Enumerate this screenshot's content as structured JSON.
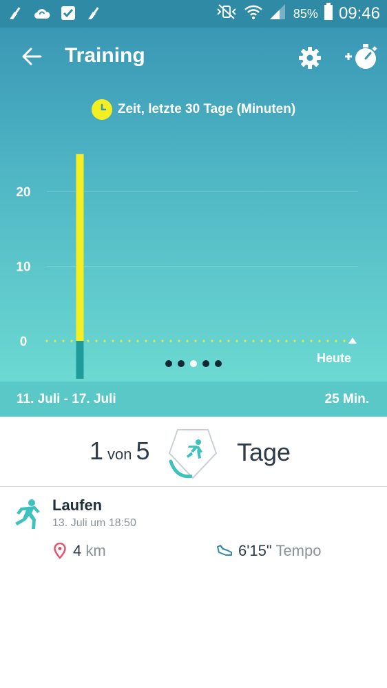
{
  "status_bar": {
    "battery_percent": "85%",
    "time": "09:46",
    "icons": [
      "cleaner-icon",
      "cloud-sync-icon",
      "checkbox-icon",
      "cleaner-icon",
      "mute-vibrate-icon",
      "wifi-icon",
      "signal-icon",
      "battery-icon"
    ]
  },
  "app_bar": {
    "title": "Training",
    "icons": [
      "back-arrow-icon",
      "gear-icon",
      "add-stopwatch-icon"
    ]
  },
  "chart": {
    "title": "Zeit, letzte 30 Tage (Minuten)",
    "today_label": "Heute",
    "page_count": 5,
    "active_page": 3
  },
  "chart_data": {
    "type": "bar",
    "title": "Zeit, letzte 30 Tage (Minuten)",
    "y_ticks": [
      0,
      10,
      20
    ],
    "ylim": [
      0,
      25
    ],
    "days": 30,
    "bars": [
      {
        "day_index": 2,
        "value": 25
      }
    ],
    "x_end_label": "Heute",
    "colors": {
      "bar": "#f3ef23",
      "bar_base": "#1e9c9c",
      "zero_line": "#f3ef23"
    }
  },
  "summary": {
    "range": "11. Juli - 17. Juli",
    "total": "25 Min."
  },
  "goal": {
    "count": "1",
    "of_word": "von",
    "target": "5",
    "unit": "Tage",
    "progress": 0.2
  },
  "activity": {
    "name": "Laufen",
    "datetime": "13. Juli um 18:50",
    "distance_value": "4",
    "distance_unit": "km",
    "pace_value": "6'15\"",
    "pace_label": "Tempo"
  },
  "colors": {
    "teal_accent": "#3fc1bd",
    "pin_red": "#e5526f",
    "bar_yellow": "#f3ef23"
  }
}
